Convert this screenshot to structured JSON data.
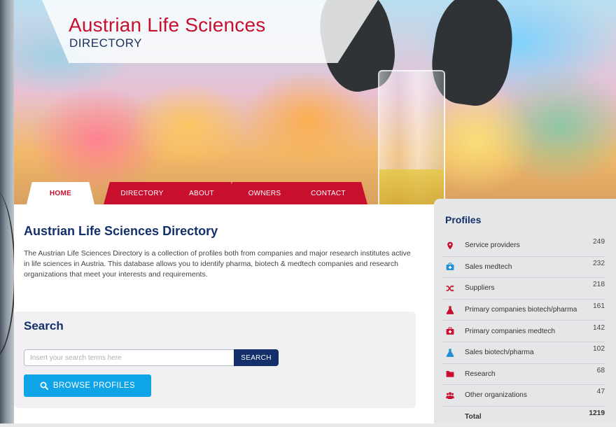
{
  "logo": {
    "title": "Austrian Life Sciences",
    "subtitle": "DIRECTORY"
  },
  "nav": {
    "tabs": [
      "HOME",
      "DIRECTORY",
      "ABOUT",
      "OWNERS",
      "CONTACT"
    ],
    "active": "HOME"
  },
  "main": {
    "title": "Austrian Life Sciences Directory",
    "intro": "The Austrian Life Sciences Directory is a collection of profiles both from companies and major research institutes active in life sciences in Austria. This database allows you to identify pharma, biotech & medtech companies and research organizations that meet your interests and requirements."
  },
  "search": {
    "title": "Search",
    "placeholder": "Insert your search terms here",
    "button_label": "SEARCH",
    "browse_label": "BROWSE PROFILES"
  },
  "profiles": {
    "title": "Profiles",
    "items": [
      {
        "label": "Service providers",
        "count": "249",
        "icon": "map-marker-icon"
      },
      {
        "label": "Sales medtech",
        "count": "232",
        "icon": "medkit-icon"
      },
      {
        "label": "Suppliers",
        "count": "218",
        "icon": "shuffle-icon"
      },
      {
        "label": "Primary companies biotech/pharma",
        "count": "161",
        "icon": "flask-icon"
      },
      {
        "label": "Primary companies medtech",
        "count": "142",
        "icon": "first-aid-icon"
      },
      {
        "label": "Sales biotech/pharma",
        "count": "102",
        "icon": "flask-icon"
      },
      {
        "label": "Research",
        "count": "68",
        "icon": "folder-icon"
      },
      {
        "label": "Other organizations",
        "count": "47",
        "icon": "users-icon"
      }
    ],
    "total_label": "Total",
    "total_count": "1219"
  },
  "colors": {
    "brand_red": "#c8102e",
    "brand_navy": "#14306a",
    "accent_blue": "#0fa4e8"
  }
}
